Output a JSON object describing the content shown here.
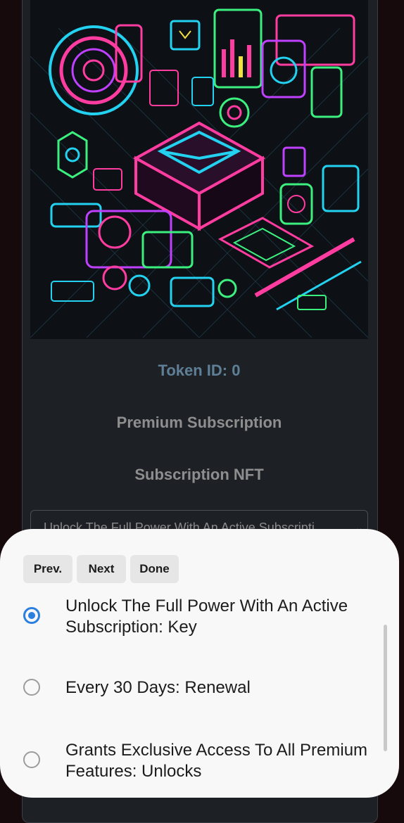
{
  "card": {
    "token_id": "Token ID: 0",
    "title": "Premium Subscription",
    "subtitle": "Subscription NFT",
    "select_value": "Unlock The Full Power With An Active Subscripti...",
    "chevron_icon": "chevron-down-icon"
  },
  "picker": {
    "prev_label": "Prev.",
    "next_label": "Next",
    "done_label": "Done",
    "options": [
      {
        "label": "Unlock The Full Power With An Active Subscription: Key",
        "selected": true
      },
      {
        "label": "Every 30 Days: Renewal",
        "selected": false
      },
      {
        "label": "Grants Exclusive Access To All Premium Features: Unlocks",
        "selected": false
      }
    ]
  },
  "colors": {
    "accent": "#2a7fe0",
    "token_id_text": "#5e7f96",
    "card_background": "#1d2126",
    "sheet_background": "#f8f8f8"
  }
}
